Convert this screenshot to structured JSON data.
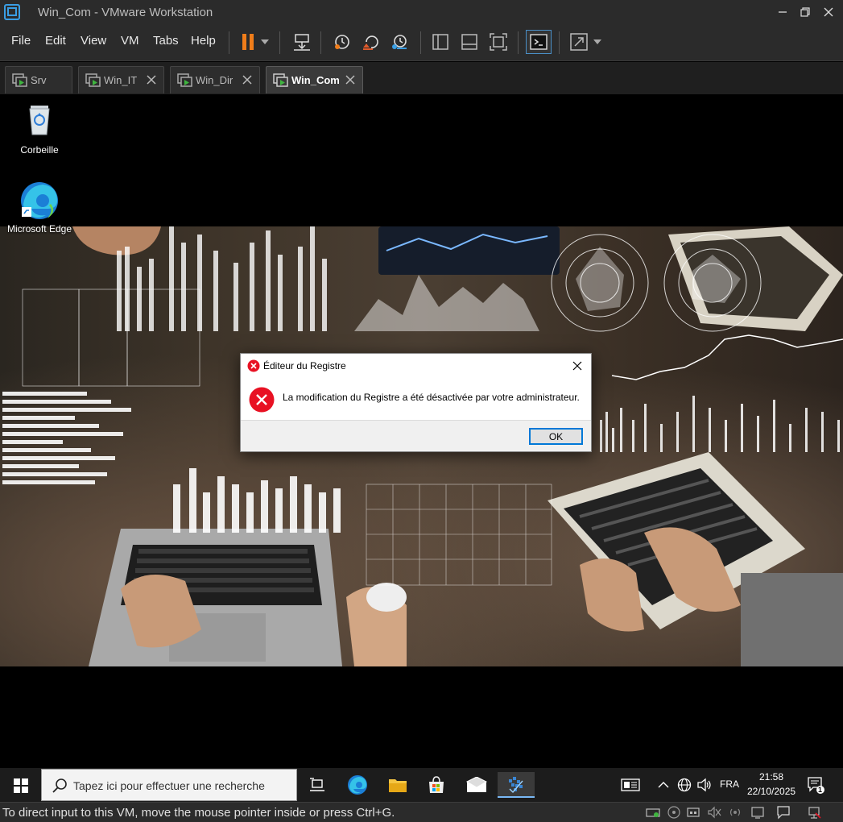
{
  "window": {
    "title": "Win_Com - VMware Workstation"
  },
  "menu": {
    "file": "File",
    "edit": "Edit",
    "view": "View",
    "vm": "VM",
    "tabs": "Tabs",
    "help": "Help"
  },
  "tabs": [
    {
      "label": "Srv",
      "active": false
    },
    {
      "label": "Win_IT",
      "active": false
    },
    {
      "label": "Win_Dir",
      "active": false
    },
    {
      "label": "Win_Com",
      "active": true
    }
  ],
  "desktop": {
    "icons": [
      {
        "label": "Corbeille",
        "icon": "recycle-bin-icon"
      },
      {
        "label": "Microsoft Edge",
        "icon": "edge-icon"
      }
    ]
  },
  "dialog": {
    "title": "Éditeur du Registre",
    "message": "La modification du Registre a été désactivée par votre administrateur.",
    "ok_label": "OK"
  },
  "taskbar": {
    "search_placeholder": "Tapez ici pour effectuer une recherche",
    "language": "FRA",
    "time": "21:58",
    "date": "22/10/2025",
    "notification_count": "1"
  },
  "statusbar": {
    "message": "To direct input to this VM, move the mouse pointer inside or press Ctrl+G."
  },
  "colors": {
    "chrome_bg": "#2b2b2b",
    "pause_orange": "#f07d1a",
    "error_red": "#e81123",
    "accent_blue": "#0078d7"
  }
}
